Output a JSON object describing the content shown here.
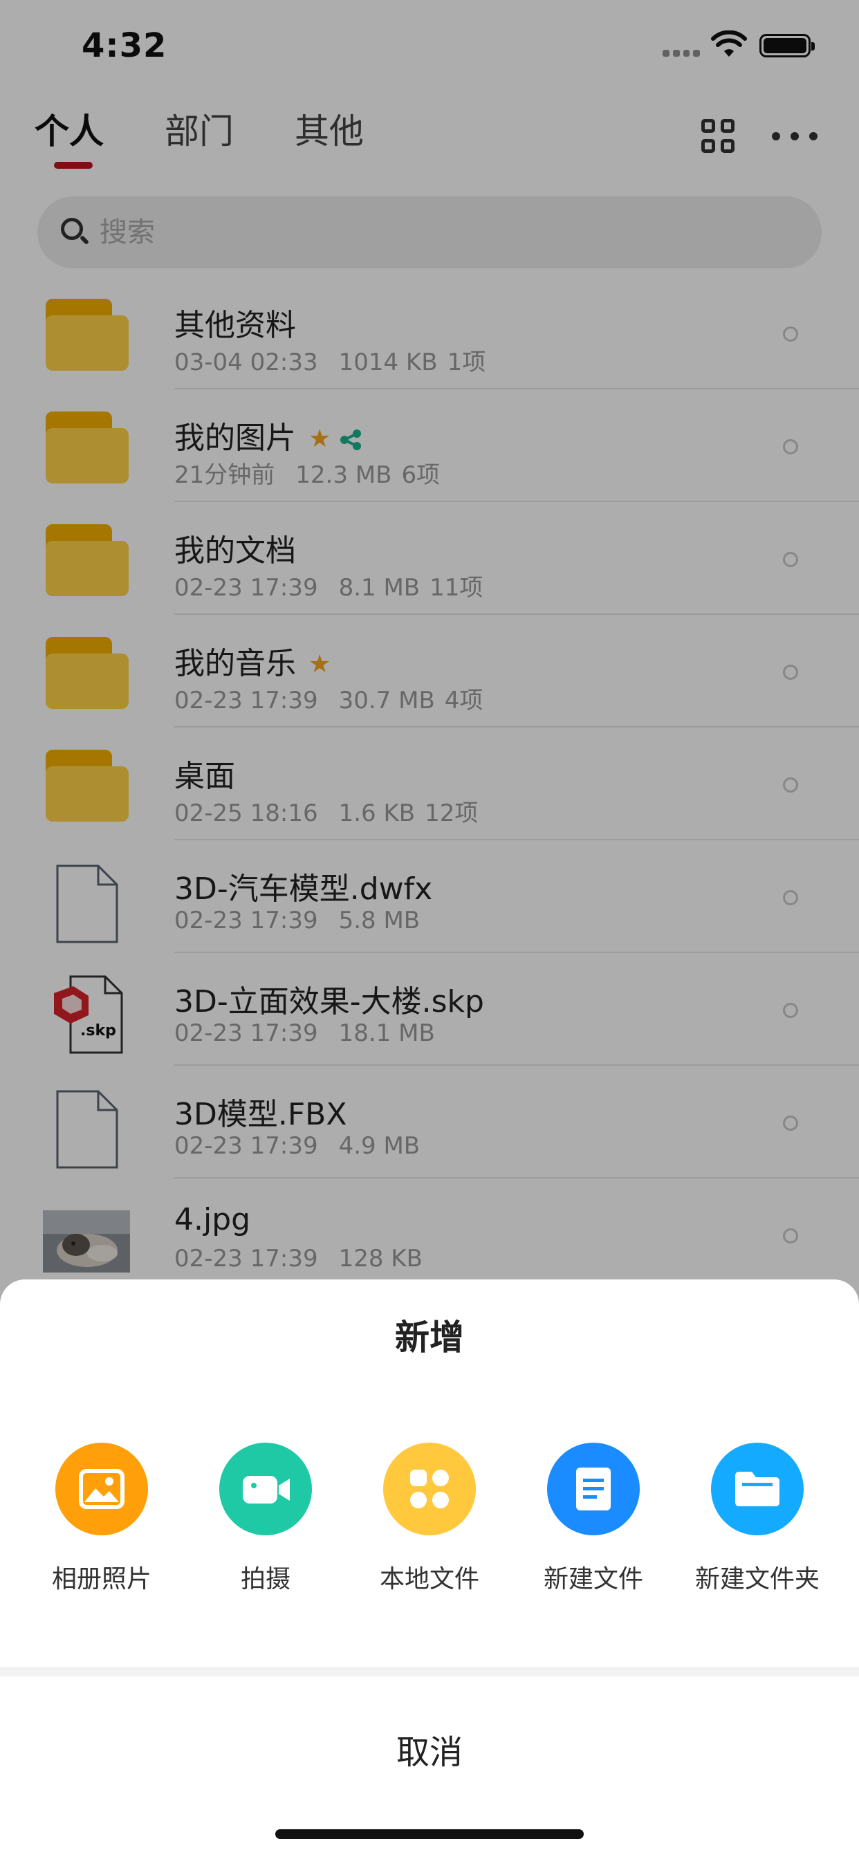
{
  "status_bar": {
    "time": "4:32"
  },
  "tabs": [
    {
      "label": "个人",
      "active": true
    },
    {
      "label": "部门",
      "active": false
    },
    {
      "label": "其他",
      "active": false
    }
  ],
  "search": {
    "placeholder": "搜索"
  },
  "files": [
    {
      "name": "其他资料",
      "date": "03-04 02:33",
      "size": "1014 KB",
      "count": "1项",
      "type": "folder"
    },
    {
      "name": "我的图片",
      "date": "21分钟前",
      "size": "12.3 MB",
      "count": "6项",
      "type": "folder",
      "starred": true,
      "shared": true
    },
    {
      "name": "我的文档",
      "date": "02-23 17:39",
      "size": "8.1 MB",
      "count": "11项",
      "type": "folder"
    },
    {
      "name": "我的音乐",
      "date": "02-23 17:39",
      "size": "30.7 MB",
      "count": "4项",
      "type": "folder",
      "starred": true
    },
    {
      "name": "桌面",
      "date": "02-25 18:16",
      "size": "1.6 KB",
      "count": "12项",
      "type": "folder"
    },
    {
      "name": "3D-汽车模型.dwfx",
      "date": "02-23 17:39",
      "size": "5.8 MB",
      "type": "document"
    },
    {
      "name": "3D-立面效果-大楼.skp",
      "date": "02-23 17:39",
      "size": "18.1 MB",
      "type": "skp",
      "skp_label": ".skp"
    },
    {
      "name": "3D模型.FBX",
      "date": "02-23 17:39",
      "size": "4.9 MB",
      "type": "document"
    },
    {
      "name": "4.jpg",
      "date": "02-23 17:39",
      "size": "128 KB",
      "type": "image"
    }
  ],
  "sheet": {
    "title": "新增",
    "actions": [
      {
        "label": "相册照片",
        "icon": "photo-icon",
        "color": "#ff9f0a"
      },
      {
        "label": "拍摄",
        "icon": "video-camera-icon",
        "color": "#20c9a6"
      },
      {
        "label": "本地文件",
        "icon": "apps-icon",
        "color": "#ffc83d"
      },
      {
        "label": "新建文件",
        "icon": "document-icon",
        "color": "#1b8cff"
      },
      {
        "label": "新建文件夹",
        "icon": "folder-icon",
        "color": "#14aaff"
      }
    ],
    "cancel": "取消"
  },
  "colors": {
    "tab_underline": "#c1121f",
    "folder": "#ffd34a",
    "star": "#f5a623",
    "share": "#19b38c"
  }
}
